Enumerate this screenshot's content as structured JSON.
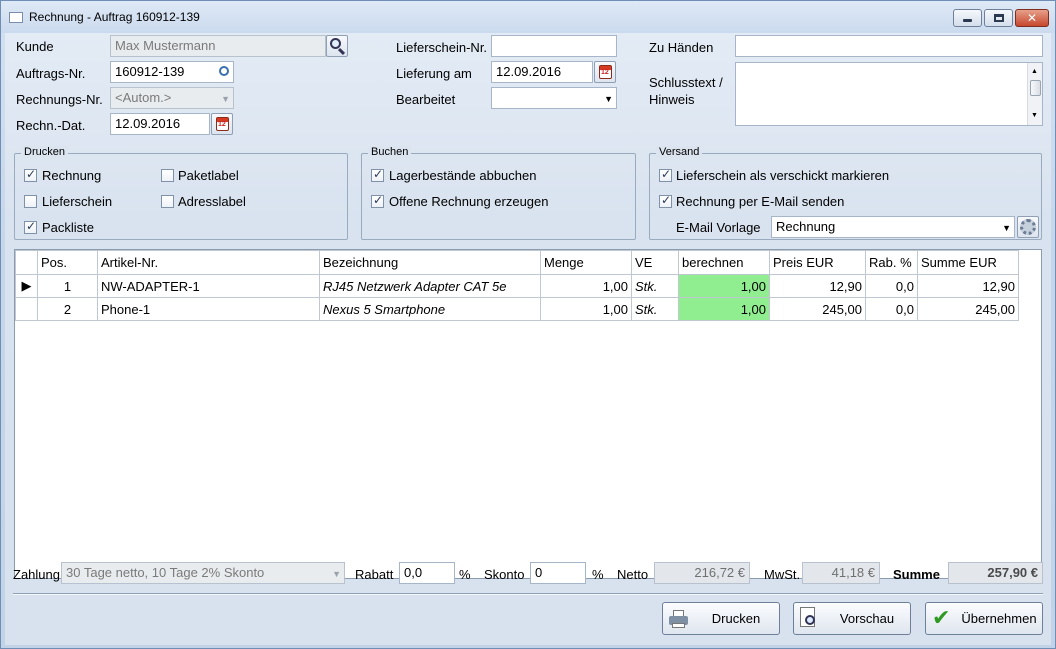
{
  "window": {
    "title": "Rechnung - Auftrag 160912-139"
  },
  "header": {
    "kunde_label": "Kunde",
    "kunde_value": "Max Mustermann",
    "auftrag_label": "Auftrags-Nr.",
    "auftrag_value": "160912-139",
    "rechnungsnr_label": "Rechnungs-Nr.",
    "rechnungsnr_value": "<Autom.>",
    "rechndat_label": "Rechn.-Dat.",
    "rechndat_value": "12.09.2016",
    "lieferschein_label": "Lieferschein-Nr.",
    "lieferschein_value": "",
    "lieferung_label": "Lieferung am",
    "lieferung_value": "12.09.2016",
    "bearbeitet_label": "Bearbeitet",
    "bearbeitet_value": "",
    "zuhaenden_label": "Zu Händen",
    "zuhaenden_value": "",
    "schlusstext_label_1": "Schlusstext /",
    "schlusstext_label_2": "Hinweis",
    "schlusstext_value": ""
  },
  "drucken": {
    "title": "Drucken",
    "rechnung": {
      "label": "Rechnung",
      "checked": true
    },
    "paketlabel": {
      "label": "Paketlabel",
      "checked": false
    },
    "lieferschein": {
      "label": "Lieferschein",
      "checked": false
    },
    "adresslabel": {
      "label": "Adresslabel",
      "checked": false
    },
    "packliste": {
      "label": "Packliste",
      "checked": true
    }
  },
  "buchen": {
    "title": "Buchen",
    "lager": {
      "label": "Lagerbestände abbuchen",
      "checked": true
    },
    "offene": {
      "label": "Offene Rechnung erzeugen",
      "checked": true
    }
  },
  "versand": {
    "title": "Versand",
    "verschickt": {
      "label": "Lieferschein als verschickt markieren",
      "checked": true
    },
    "email": {
      "label": "Rechnung per E-Mail senden",
      "checked": true
    },
    "vorlage_label": "E-Mail Vorlage",
    "vorlage_value": "Rechnung"
  },
  "grid": {
    "columns": [
      "Pos.",
      "Artikel-Nr.",
      "Bezeichnung",
      "Menge",
      "VE",
      "berechnen",
      "Preis EUR",
      "Rab. %",
      "Summe EUR"
    ],
    "rows": [
      {
        "indicator": "▶",
        "pos": "1",
        "artikel": "NW-ADAPTER-1",
        "bezeichnung": "RJ45 Netzwerk Adapter CAT 5e",
        "menge": "1,00",
        "ve": "Stk.",
        "berechnen": "1,00",
        "preis": "12,90",
        "rabatt": "0,0",
        "summe": "12,90"
      },
      {
        "indicator": "",
        "pos": "2",
        "artikel": "Phone-1",
        "bezeichnung": "Nexus 5 Smartphone",
        "menge": "1,00",
        "ve": "Stk.",
        "berechnen": "1,00",
        "preis": "245,00",
        "rabatt": "0,0",
        "summe": "245,00"
      }
    ]
  },
  "footer": {
    "zahlung_label": "Zahlung",
    "zahlung_value": "30 Tage netto, 10 Tage 2% Skonto",
    "rabatt_label": "Rabatt",
    "rabatt_value": "0,0",
    "rabatt_unit": "%",
    "skonto_label": "Skonto",
    "skonto_value": "0",
    "skonto_unit": "%",
    "netto_label": "Netto",
    "netto_value": "216,72 €",
    "mwst_label": "MwSt.",
    "mwst_value": "41,18 €",
    "summe_label": "Summe",
    "summe_value": "257,90 €"
  },
  "buttons": {
    "drucken": "Drucken",
    "vorschau": "Vorschau",
    "uebernehmen": "Übernehmen"
  },
  "colors": {
    "berechnen_bg": "#90ee90",
    "accent": "#2e9a22"
  }
}
